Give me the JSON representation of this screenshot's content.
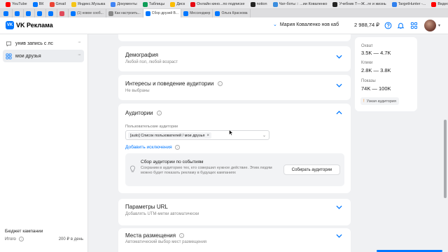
{
  "browser": {
    "bookmarks": [
      {
        "label": "YouTube",
        "color": "#ff0000"
      },
      {
        "label": "ВК",
        "color": "#0077ff"
      },
      {
        "label": "Gmail",
        "color": "#ea4335"
      },
      {
        "label": "Яндекс.Музыка",
        "color": "#f5c518"
      },
      {
        "label": "Документы",
        "color": "#4285f4"
      },
      {
        "label": "Таблицы",
        "color": "#0f9d58"
      },
      {
        "label": "Диск",
        "color": "#fbbc04"
      },
      {
        "label": "Онлайн кино...по подписке",
        "color": "#e50914"
      },
      {
        "label": "notion",
        "color": "#222222"
      },
      {
        "label": "Чат-боты :: ...ии Коваленко",
        "color": "#3a8dde"
      },
      {
        "label": "Учебник Т—Ж...ге и жизнь",
        "color": "#222222"
      },
      {
        "label": "TargetHunter -...",
        "color": "#2f80ed"
      },
      {
        "label": "Видео - Студи...",
        "color": "#ff0000"
      }
    ],
    "tabs": [
      {
        "label": "",
        "color": "#0077ff"
      },
      {
        "label": "",
        "color": "#0077ff"
      },
      {
        "label": "",
        "color": "#0077ff"
      },
      {
        "label": "",
        "color": "#0077ff"
      },
      {
        "label": "",
        "color": "#0077ff"
      },
      {
        "label": "",
        "color": "#e04a5a"
      },
      {
        "label": "(1) новое сооб...",
        "color": "#0077ff"
      },
      {
        "label": "Как настроить...",
        "color": "#888888"
      },
      {
        "label": "Сбор друзей В...",
        "color": "#0077ff"
      },
      {
        "label": "Мессенджер",
        "color": "#0077ff"
      },
      {
        "label": "Ольга Краснова",
        "color": "#0077ff"
      }
    ]
  },
  "header": {
    "logo_mark": "VK",
    "logo_text": "VK Реклама",
    "account_name": "Мария Коваленко нов каб",
    "balance": "2 988,74 ₽"
  },
  "sidebar": {
    "items": [
      {
        "label": "унив запись с лс",
        "dots": "···"
      },
      {
        "label": "мои друзья",
        "dots": "···"
      }
    ],
    "budget_title": "Бюджет кампании",
    "budget_label": "Итого",
    "budget_value": "200 ₽ в день"
  },
  "cards": {
    "demography_title": "Демография",
    "demography_sub": "Любой пол, любой возраст",
    "interests_title": "Интересы и поведение аудитории",
    "interests_sub": "Не выбраны",
    "audiences_title": "Аудитории",
    "audiences_field_label": "Пользовательские аудитории",
    "audiences_chip": "[auto] Список пользователей / мои друзья",
    "add_exclusions": "Добавить исключения",
    "event_title": "Сбор аудитории по событиям",
    "event_text": "Сохраним в аудиторию тех, кто совершил нужное действие. Этим людям можно будет показать рекламу в будущих кампаниях",
    "collect_button": "Собирать аудитории",
    "url_title": "Параметры URL",
    "url_sub": "Добавлять UTM-метки автоматически",
    "placements_title": "Места размещения",
    "placements_sub": "Автоматический выбор мест размещения"
  },
  "forecast": {
    "reach_label": "Охват",
    "reach_value": "3.5K — 4.7K",
    "clicks_label": "Клики",
    "clicks_value": "2.8K — 3.8K",
    "impressions_label": "Показы",
    "impressions_value": "74K — 100K",
    "badge": "Узкая аудитория",
    "badge_icon": "!"
  },
  "colors": {
    "accent": "#0077ff",
    "warning": "#f58a1f"
  }
}
